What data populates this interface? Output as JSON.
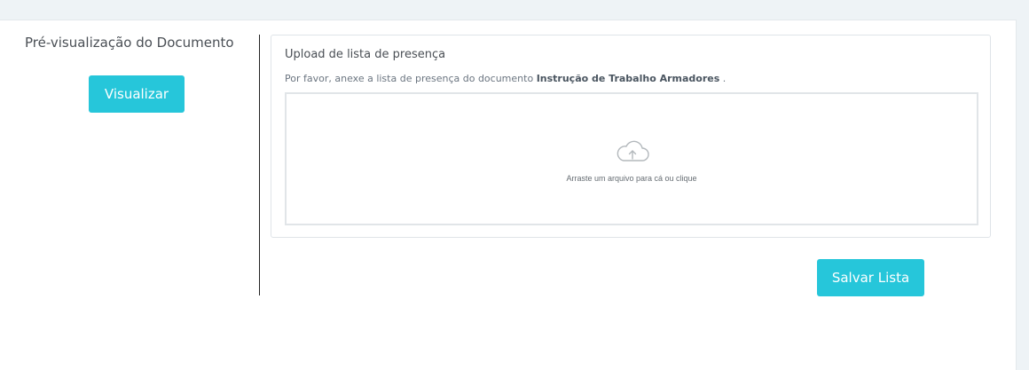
{
  "preview": {
    "title": "Pré-visualização do Documento",
    "button_label": "Visualizar"
  },
  "upload": {
    "title": "Upload de lista de presença",
    "description_prefix": "Por favor, anexe a lista de presença do documento",
    "document_name": "Instrução de Trabalho Armadores",
    "description_suffix": ".",
    "dropzone_text": "Arraste um arquivo para cá ou clique",
    "dropzone_icon": "cloud-upload-icon"
  },
  "actions": {
    "save_label": "Salvar Lista"
  },
  "colors": {
    "accent": "#26c6da",
    "page_background": "#eef3f6"
  }
}
